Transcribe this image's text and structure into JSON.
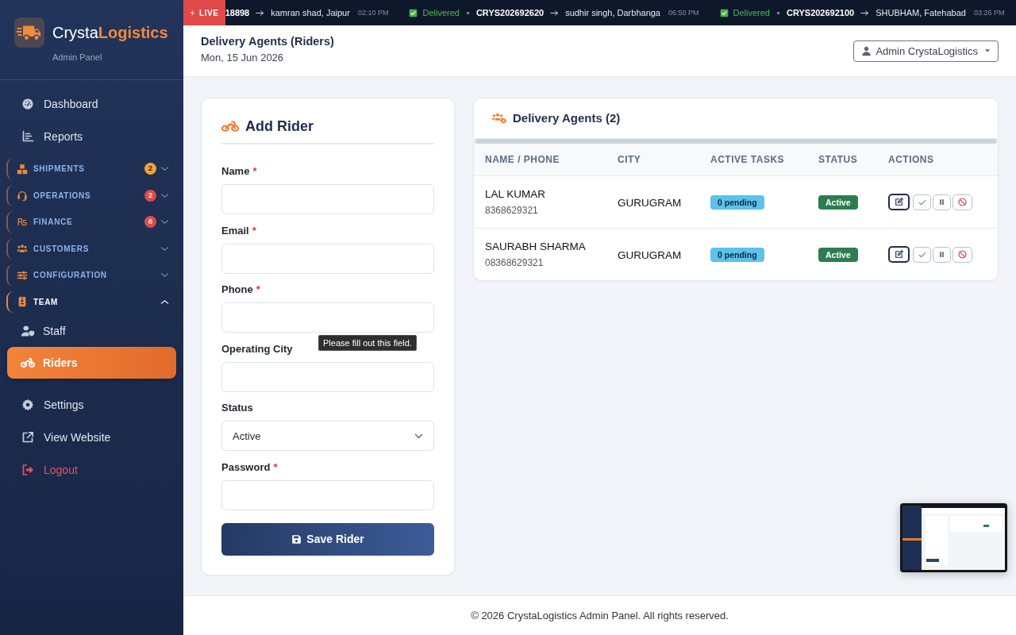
{
  "sidebar": {
    "brand": {
      "name_start": "Crysta",
      "name_end": "Logistics",
      "subtitle": "Admin Panel"
    },
    "items": [
      {
        "kind": "link",
        "label": "Dashboard",
        "selected": false
      },
      {
        "kind": "link",
        "label": "Reports",
        "selected": false
      },
      {
        "kind": "group",
        "label": "SHIPMENTS",
        "expanded": false,
        "badge": {
          "text": "2",
          "color": "#f0a532"
        }
      },
      {
        "kind": "group",
        "label": "OPERATIONS",
        "expanded": false,
        "badge": {
          "text": "2",
          "color": "#e04b4b"
        }
      },
      {
        "kind": "group",
        "label": "FINANCE",
        "icon_glyph": "₨",
        "expanded": false,
        "badge": {
          "text": "6",
          "color": "#e04b4b"
        }
      },
      {
        "kind": "group",
        "label": "CUSTOMERS",
        "expanded": false
      },
      {
        "kind": "group",
        "label": "CONFIGURATION",
        "expanded": false
      },
      {
        "kind": "group",
        "label": "TEAM",
        "expanded": true,
        "children": [
          {
            "label": "Staff",
            "selected": false
          },
          {
            "label": "Riders",
            "selected": true
          }
        ]
      },
      {
        "kind": "link",
        "label": "Settings",
        "selected": false
      },
      {
        "kind": "link",
        "label": "View Website",
        "selected": false
      },
      {
        "kind": "logout",
        "label": "Logout",
        "selected": false
      }
    ]
  },
  "ticker": {
    "badge": "LIVE",
    "entries": [
      {
        "code": "18898",
        "recipient": "kamran shad, Jaipur",
        "time": "02:10 PM"
      },
      {
        "status": "Delivered",
        "code": "CRYS202692620",
        "recipient": "sudhir singh, Darbhanga",
        "time": "06:50 PM"
      },
      {
        "status": "Delivered",
        "code": "CRYS202692100",
        "recipient": "SHUBHAM, Fatehabad",
        "time": "03:26 PM"
      }
    ]
  },
  "header": {
    "title": "Delivery Agents (Riders)",
    "date": "Mon, 15 Jun 2026",
    "user_menu": "Admin CrystaLogistics"
  },
  "form": {
    "title": "Add Rider",
    "fields": [
      {
        "kind": "input",
        "label": "Name",
        "mark": "*"
      },
      {
        "kind": "input",
        "label": "Email",
        "mark": "*"
      },
      {
        "kind": "input",
        "label": "Phone",
        "mark": "*",
        "tooltip": "Please fill out this field."
      },
      {
        "kind": "input",
        "label": "Operating City"
      },
      {
        "kind": "select",
        "label": "Status",
        "value": "Active"
      },
      {
        "kind": "input",
        "label": "Password",
        "mark": "*"
      }
    ],
    "submit": "Save Rider"
  },
  "agents": {
    "title": "Delivery Agents (2)",
    "columns": [
      "NAME / PHONE",
      "CITY",
      "ACTIVE TASKS",
      "STATUS",
      "ACTIONS"
    ],
    "rows": [
      {
        "name": "LAL KUMAR",
        "phone": "8368629321",
        "city": "GURUGRAM",
        "tasks": "0 pending",
        "status": "Active"
      },
      {
        "name": "SAURABH SHARMA",
        "phone": "08368629321",
        "city": "GURUGRAM",
        "tasks": "0 pending",
        "status": "Active"
      }
    ]
  },
  "footer": {
    "text": "© 2026 CrystaLogistics Admin Panel. All rights reserved."
  }
}
